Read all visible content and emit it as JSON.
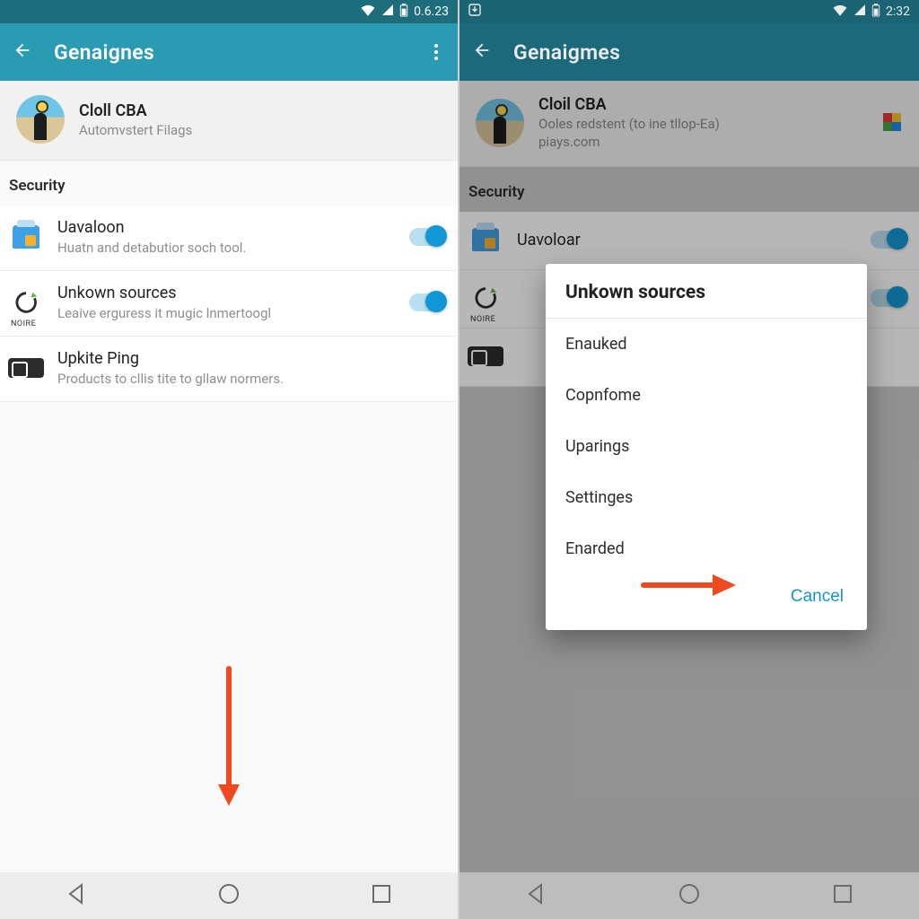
{
  "left": {
    "status": {
      "time": "0.6.23"
    },
    "appbar": {
      "title": "Genaignes"
    },
    "profile": {
      "name": "Cloll CBA",
      "sub": "Automvstert Filags"
    },
    "section": "Security",
    "items": [
      {
        "title": "Uavaloon",
        "sub": "Huatn and detabutior soch tool."
      },
      {
        "title": "Unkown sources",
        "sub": "Leaive erguress it mugic lnmertoogl"
      },
      {
        "title": "Upkite Ping",
        "sub": "Products to cllis tite to gllaw normers."
      }
    ],
    "sync_label": "NOIRE"
  },
  "right": {
    "status": {
      "time": "2:32"
    },
    "appbar": {
      "title": "Genaigmes"
    },
    "profile": {
      "name": "Cloil CBA",
      "sub": "Ooles redstent (to ine tllop-Ea)",
      "sub2": "piays.com"
    },
    "section": "Security",
    "items": [
      {
        "title": "Uavoloar"
      }
    ],
    "sync_label": "NOIRE",
    "dialog": {
      "title": "Unkown sources",
      "options": [
        "Enauked",
        "Copnfome",
        "Uparings",
        "Settinges",
        "Enarded"
      ],
      "cancel": "Cancel"
    }
  }
}
